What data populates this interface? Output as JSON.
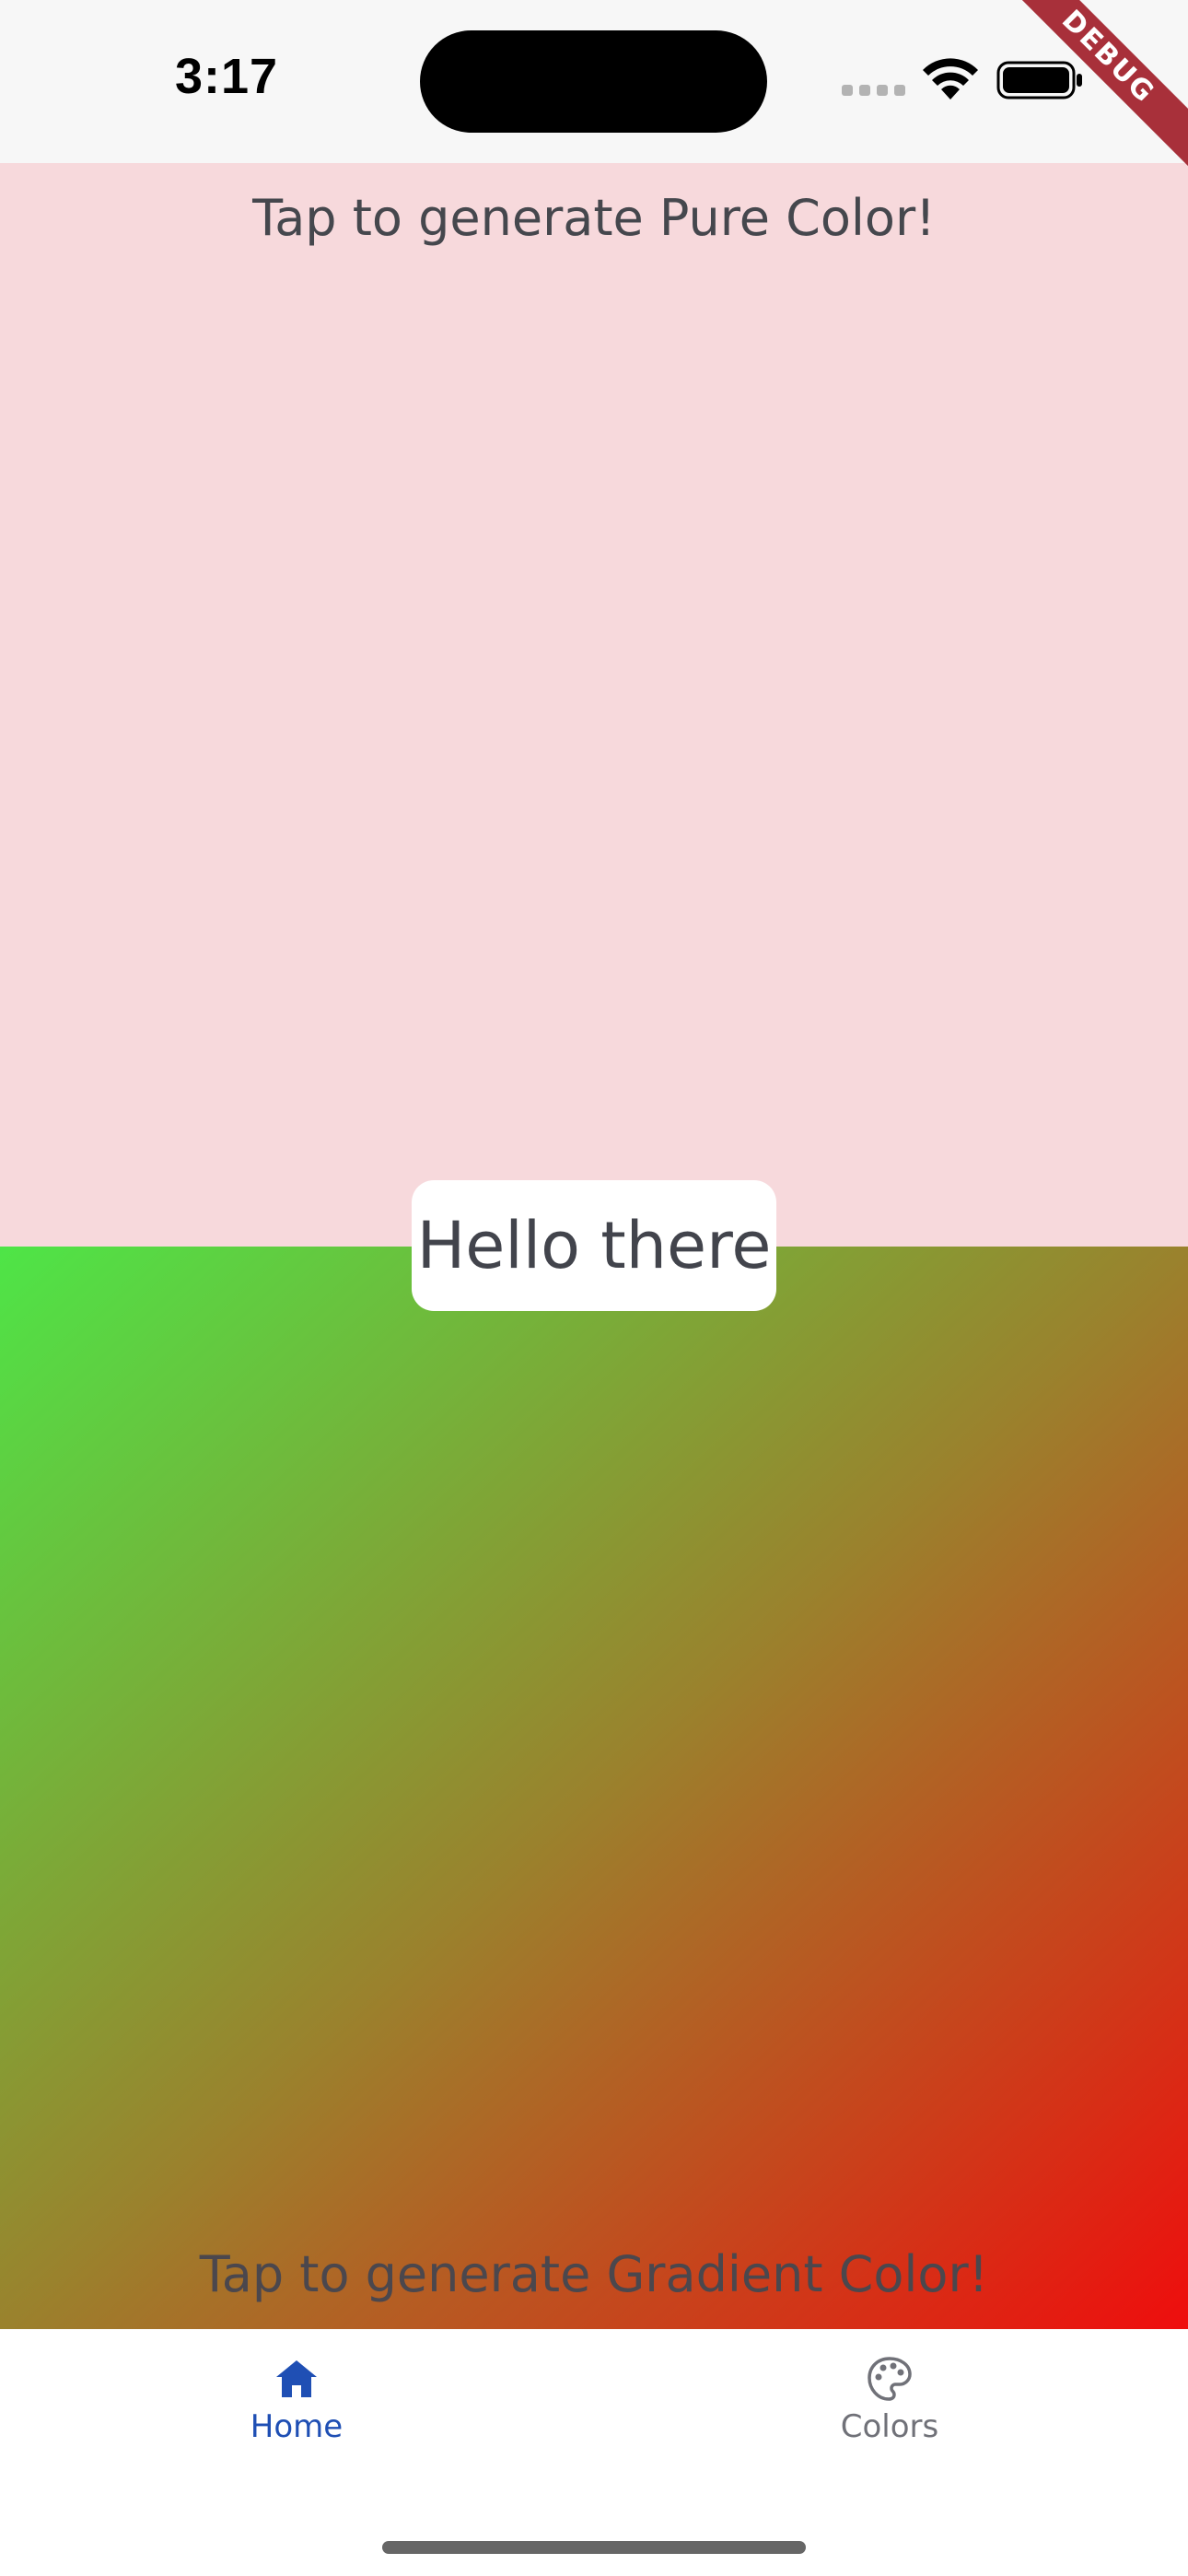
{
  "status_bar": {
    "time": "3:17",
    "signal_icon": "cellular-signal-icon",
    "wifi_icon": "wifi-icon",
    "battery_icon": "battery-icon"
  },
  "debug_banner": {
    "label": "DEBUG",
    "color": "#a8303a"
  },
  "pure_color_panel": {
    "label": "Tap to generate Pure Color!",
    "background": "#f7d9dc"
  },
  "center_card": {
    "text": "Hello there"
  },
  "gradient_color_panel": {
    "label": "Tap to generate Gradient Color!",
    "gradient_start": "#4ee547",
    "gradient_end": "#ef0d0d"
  },
  "bottom_nav": {
    "items": [
      {
        "label": "Home",
        "icon": "home-icon",
        "selected": true,
        "color": "#1f4fb4"
      },
      {
        "label": "Colors",
        "icon": "palette-icon",
        "selected": false,
        "color": "#707178"
      }
    ]
  }
}
